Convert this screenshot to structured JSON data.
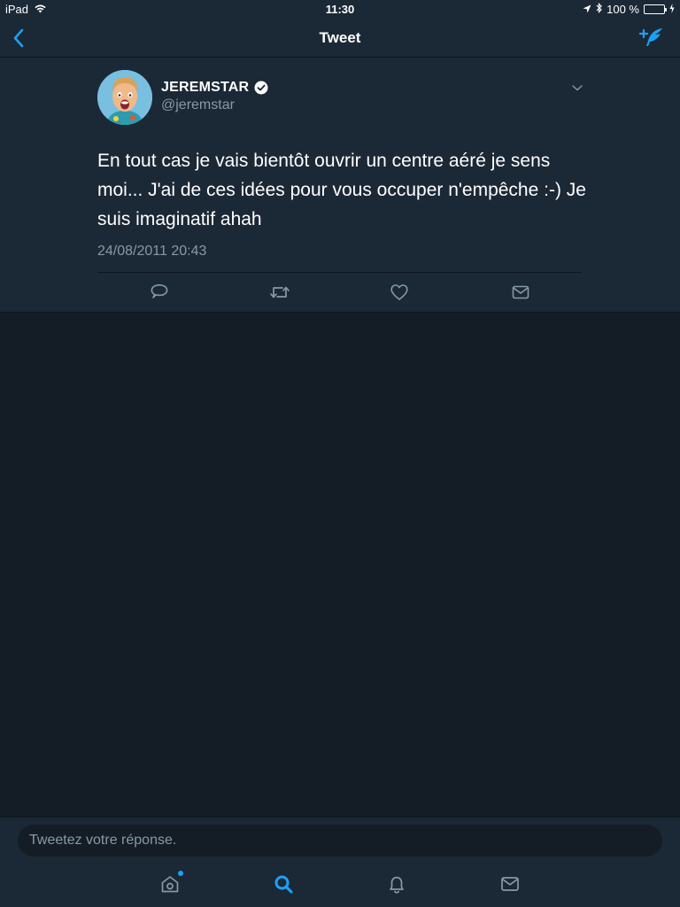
{
  "status_bar": {
    "device": "iPad",
    "time": "11:30",
    "battery_percent": "100 %",
    "battery_level": 1.0
  },
  "nav": {
    "title": "Tweet",
    "back_icon": "chevron-left-icon",
    "compose_icon": "compose-tweet-icon"
  },
  "tweet": {
    "author_name": "JEREMSTAR",
    "verified": true,
    "handle": "@jeremstar",
    "text": "En tout cas je vais bientôt ouvrir un centre aéré je sens moi... J'ai de ces idées pour vous occuper n'empêche :-) Je suis imaginatif ahah",
    "timestamp": "24/08/2011 20:43",
    "actions": [
      "reply-icon",
      "retweet-icon",
      "like-icon",
      "direct-message-icon"
    ]
  },
  "reply": {
    "placeholder": "Tweetez votre réponse."
  },
  "tabs": [
    {
      "name": "home",
      "icon": "home-icon",
      "active": false,
      "has_notification_dot": true
    },
    {
      "name": "search",
      "icon": "search-icon",
      "active": true,
      "has_notification_dot": false
    },
    {
      "name": "notifications",
      "icon": "bell-icon",
      "active": false,
      "has_notification_dot": false
    },
    {
      "name": "messages",
      "icon": "envelope-icon",
      "active": false,
      "has_notification_dot": false
    }
  ],
  "colors": {
    "accent": "#1da1f2",
    "panel": "#1b2836",
    "background": "#141d26",
    "secondary_text": "#8899a6",
    "battery": "#4cd964"
  }
}
